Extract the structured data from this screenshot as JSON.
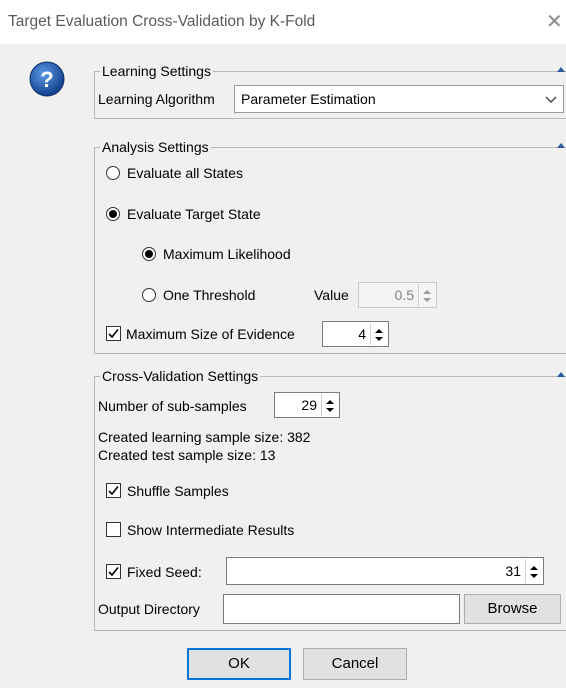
{
  "window": {
    "title": "Target Evaluation Cross-Validation by K-Fold"
  },
  "learning": {
    "title": "Learning Settings",
    "algorithm_label": "Learning Algorithm",
    "algorithm_value": "Parameter Estimation"
  },
  "analysis": {
    "title": "Analysis Settings",
    "all_states_label": "Evaluate all States",
    "all_states_selected": false,
    "target_state_label": "Evaluate Target State",
    "target_state_selected": true,
    "max_likelihood_label": "Maximum Likelihood",
    "max_likelihood_selected": true,
    "one_threshold_label": "One Threshold",
    "one_threshold_selected": false,
    "value_label": "Value",
    "value": "0.5",
    "max_evidence_label": "Maximum Size of Evidence",
    "max_evidence_checked": true,
    "max_evidence_value": "4"
  },
  "cv": {
    "title": "Cross-Validation Settings",
    "subsamples_label": "Number of sub-samples",
    "subsamples_value": "29",
    "learning_size_text": "Created learning sample size: 382",
    "test_size_text": "Created test sample size: 13",
    "shuffle_label": "Shuffle Samples",
    "shuffle_checked": true,
    "intermediate_label": "Show Intermediate Results",
    "intermediate_checked": false,
    "fixed_seed_label": "Fixed Seed:",
    "fixed_seed_checked": true,
    "fixed_seed_value": "31",
    "output_dir_label": "Output Directory",
    "output_dir_value": "",
    "browse_label": "Browse"
  },
  "buttons": {
    "ok": "OK",
    "cancel": "Cancel"
  },
  "icons": {
    "help": "question-mark-icon",
    "collapse": "collapse-triangle-icon",
    "close": "close-icon",
    "dropdown": "chevron-down-icon"
  },
  "colors": {
    "help_blue": "#1c5fb0",
    "dialog_bg": "#f0f0f0",
    "default_button_border": "#0078d7"
  }
}
